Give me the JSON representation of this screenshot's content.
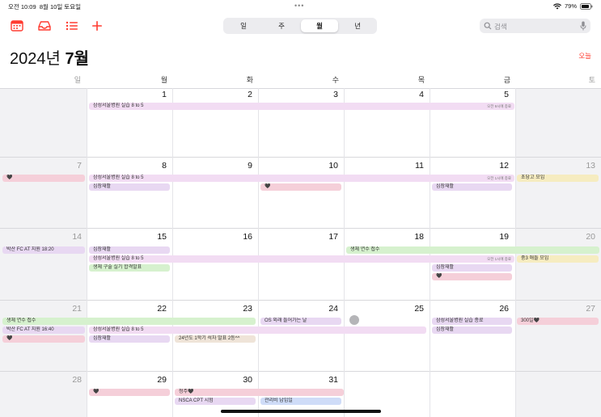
{
  "status": {
    "time": "오전 10:09",
    "date": "8월 10일 토요일",
    "battery": "79%"
  },
  "toolbar": {
    "icons": [
      "calendar-icon",
      "inbox-icon",
      "list-icon",
      "add-icon"
    ]
  },
  "segment": {
    "options": [
      "일",
      "주",
      "월",
      "년"
    ],
    "selected": "월"
  },
  "search": {
    "placeholder": "검색"
  },
  "header": {
    "year": "2024년",
    "month": "7월",
    "today_button": "오늘"
  },
  "weekdays": [
    "일",
    "월",
    "화",
    "수",
    "목",
    "금",
    "토"
  ],
  "weeks": [
    {
      "days": [
        "",
        "1",
        "2",
        "3",
        "4",
        "5",
        ""
      ]
    },
    {
      "days": [
        "7",
        "8",
        "9",
        "10",
        "11",
        "12",
        "13"
      ]
    },
    {
      "days": [
        "14",
        "15",
        "16",
        "17",
        "18",
        "19",
        "20"
      ]
    },
    {
      "days": [
        "21",
        "22",
        "23",
        "24",
        "25",
        "26",
        "27"
      ]
    },
    {
      "days": [
        "28",
        "29",
        "30",
        "31",
        "",
        "",
        ""
      ]
    }
  ],
  "events": {
    "w1_span": {
      "title": "삼성서울병원 실습 8 to 5",
      "side": "오전 9시에 종료"
    },
    "w2_heart_sun": {
      "title": "🖤"
    },
    "w2_span": {
      "title": "삼성서울병원 실습 8 to 5",
      "side": "오전 1시에 종료"
    },
    "w2_rehab_mon": {
      "title": "심장재활"
    },
    "w2_heart_wed": {
      "title": "🖤"
    },
    "w2_rehab_fri": {
      "title": "심장재활"
    },
    "w2_sat_meet": {
      "title": "초당고 모임"
    },
    "w3_sun_fc": {
      "title": "박산 FC AT 지원 18:20"
    },
    "w3_rehab_mon": {
      "title": "심장재활"
    },
    "w3_span": {
      "title": "삼성서울병원 실습 8 to 5",
      "side": "오전 1시에 종료"
    },
    "w3_exam": {
      "title": "생체 구술 실기 합격발표"
    },
    "w3_green_span": {
      "title": "생체 연수 접수"
    },
    "w3_rehab_fri": {
      "title": "심장재활"
    },
    "w3_heart_fri": {
      "title": "🖤"
    },
    "w3_sat_meet": {
      "title": "중3 애들 모임"
    },
    "w4_green": {
      "title": "생체 연수 접수"
    },
    "w4_sun_fc": {
      "title": "박산 FC AT 지원 16:40"
    },
    "w4_heart_sun": {
      "title": "🖤"
    },
    "w4_span": {
      "title": "삼성서울병원 실습 8 to 5"
    },
    "w4_rehab_mon": {
      "title": "심장재활"
    },
    "w4_tue": {
      "title": "24년도 1학기 석차 발표 2등^^"
    },
    "w4_wed": {
      "title": "OS 외래 들어가는 날"
    },
    "w4_fri_end": {
      "title": "삼성서울병원 실습 종료"
    },
    "w4_fri_rehab": {
      "title": "심장재활"
    },
    "w4_sat": {
      "title": "300일🖤"
    },
    "w5_heart_mon": {
      "title": "🖤"
    },
    "w5_tue_a": {
      "title": "청주🖤"
    },
    "w5_tue_b": {
      "title": "NSCA CPT 시험"
    },
    "w5_wed": {
      "title": "관리비 납입일"
    }
  }
}
